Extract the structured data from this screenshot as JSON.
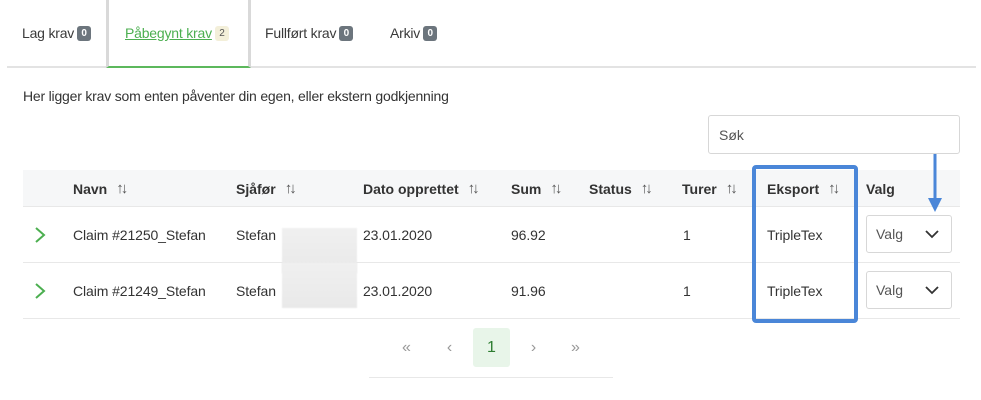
{
  "tabs": [
    {
      "label": "Lag krav",
      "count": "0"
    },
    {
      "label": "Påbegynt krav",
      "count": "2"
    },
    {
      "label": "Fullført krav",
      "count": "0"
    },
    {
      "label": "Arkiv",
      "count": "0"
    }
  ],
  "description": "Her ligger krav som enten påventer din egen, eller ekstern godkjenning",
  "search": {
    "placeholder": "Søk"
  },
  "table": {
    "headers": {
      "name": "Navn",
      "driver": "Sjåfør",
      "date": "Dato opprettet",
      "sum": "Sum",
      "status": "Status",
      "trips": "Turer",
      "export": "Eksport",
      "options": "Valg"
    },
    "rows": [
      {
        "name": "Claim #21250_Stefan",
        "driver": "Stefan",
        "date": "23.01.2020",
        "sum": "96.92",
        "status": "",
        "trips": "1",
        "export": "TripleTex",
        "options": "Valg"
      },
      {
        "name": "Claim #21249_Stefan",
        "driver": "Stefan",
        "date": "23.01.2020",
        "sum": "91.96",
        "status": "",
        "trips": "1",
        "export": "TripleTex",
        "options": "Valg"
      }
    ]
  },
  "pagination": {
    "first": "«",
    "prev": "‹",
    "current": "1",
    "next": "›",
    "last": "»"
  },
  "icons": {
    "sort": "sort-arrows-icon",
    "expand": "chevron-right-icon",
    "dropdown": "chevron-down-icon"
  },
  "colors": {
    "accent": "#4caf50",
    "highlight": "#4a86d8",
    "badge": "#6c757d"
  }
}
